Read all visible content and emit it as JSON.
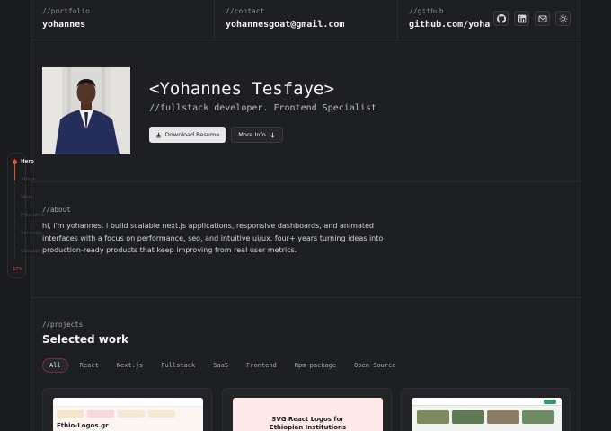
{
  "topbar": {
    "portfolio": {
      "label": "//portfolio",
      "value": "yohannes"
    },
    "contact": {
      "label": "//contact",
      "value": "yohannesgoat@gmail.com"
    },
    "github": {
      "label": "//github",
      "value": "github.com/yohan…"
    },
    "icons": [
      "github-icon",
      "linkedin-icon",
      "mail-icon",
      "theme-sun-icon"
    ]
  },
  "hero": {
    "name": "<Yohannes Tesfaye>",
    "role": "//fullstack developer. Frontend Specialist",
    "download_label": "Download Resume",
    "more_label": "More Info"
  },
  "about": {
    "label": "//about",
    "text": "hi, i'm yohannes. i build scalable next.js applications, responsive dashboards, and animated interfaces with a focus on performance, seo, and intuitive ui/ux. four+ years turning ideas into production-ready products that keep improving from real user metrics."
  },
  "projects": {
    "label": "//projects",
    "title": "Selected work",
    "filters": [
      "All",
      "React",
      "Next.js",
      "Fullstack",
      "SaaS",
      "Frontend",
      "Npm package",
      "Open Source"
    ],
    "active_filter": "All",
    "cards": [
      {
        "thumb_title": "Ethio-Logos.gr"
      },
      {
        "thumb_title": "SVG React Logos for Ethiopian Institutions"
      },
      {
        "thumb_title": ""
      }
    ]
  },
  "sidenav": {
    "items": [
      "Hero",
      "About",
      "Work",
      "Education",
      "Services",
      "Contact"
    ],
    "active": "Hero",
    "progress": "17%",
    "progress_fraction": 0.17
  },
  "colors": {
    "accent": "#e0523a",
    "bg": "#1a1b1e",
    "panel": "#1e1f23"
  }
}
